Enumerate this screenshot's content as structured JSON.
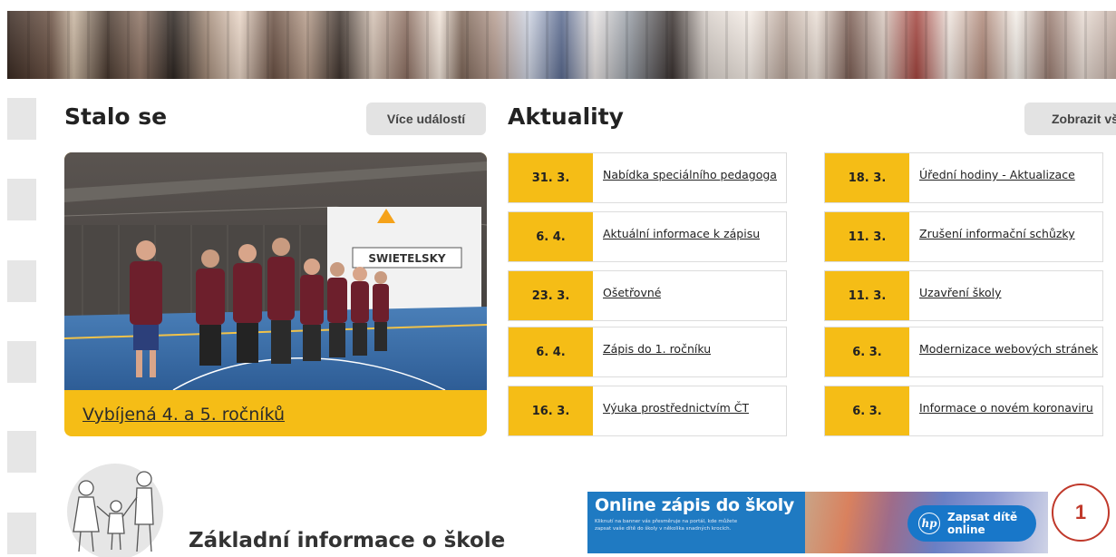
{
  "events": {
    "title": "Stalo se",
    "more_button": "Více událostí",
    "featured_caption": "Vybíjená 4. a 5. ročníků",
    "photo_sign": "SWIETELSKY"
  },
  "news": {
    "title": "Aktuality",
    "all_button": "Zobrazit vše",
    "left_column": [
      {
        "date": "31. 3.",
        "title": "Nabídka speciálního pedagoga"
      },
      {
        "date": "6. 4.",
        "title": "Aktuální informace k zápisu"
      },
      {
        "date": "23. 3.",
        "title": "Ošetřovné"
      },
      {
        "date": "6. 4.",
        "title": "Zápis do 1. ročníku"
      },
      {
        "date": "16. 3.",
        "title": "Výuka prostřednictvím ČT"
      }
    ],
    "right_column": [
      {
        "date": "18. 3.",
        "title": "Úřední hodiny - Aktualizace"
      },
      {
        "date": "11. 3.",
        "title": "Zrušení informační schůzky"
      },
      {
        "date": "11. 3.",
        "title": "Uzavření školy"
      },
      {
        "date": "6. 3.",
        "title": "Modernizace webových stránek"
      },
      {
        "date": "6. 3.",
        "title": "Informace o novém koronaviru"
      }
    ]
  },
  "school_info": {
    "title": "Základní informace o škole"
  },
  "registration_banner": {
    "title": "Online zápis do školy",
    "subtitle_line1": "Kliknutí na banner vás přesměruje na portál, kde můžete",
    "subtitle_line2": "zapsat vaše dítě do školy v několika snadných krocích.",
    "button_line1": "Zapsat dítě",
    "button_line2": "online",
    "logo_text": "hp"
  },
  "callout_number": "1",
  "colors": {
    "accent_yellow": "#f5bd16",
    "button_grey": "#e3e3e3",
    "banner_blue": "#1f7ac2",
    "callout_red": "#c0392b"
  }
}
